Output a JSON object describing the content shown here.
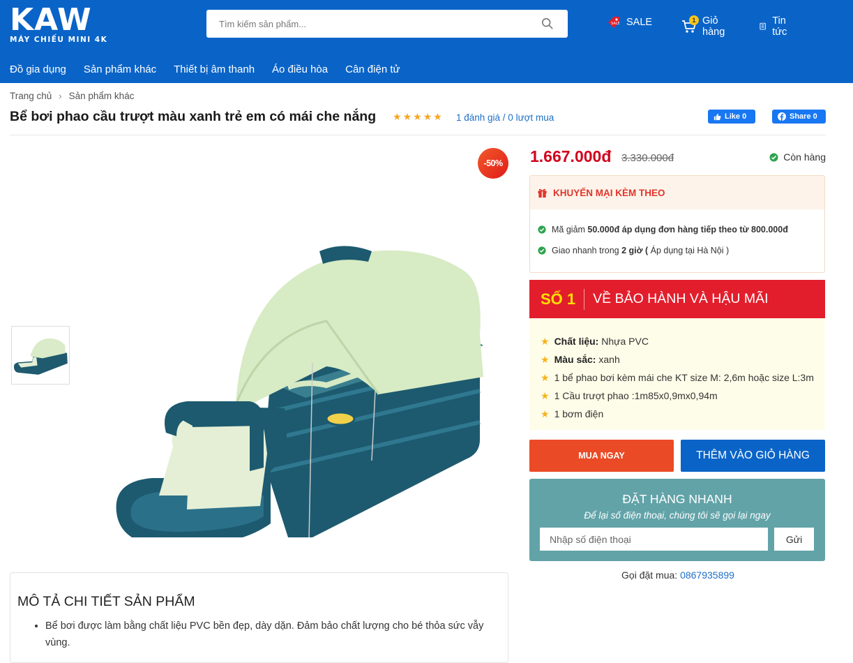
{
  "header": {
    "logo_big": "KAW",
    "logo_small": "MÁY CHIẾU MINI 4K",
    "search_placeholder": "Tìm kiếm sản phẩm...",
    "sale_label": "SALE",
    "cart_label": "Giỏ hàng",
    "cart_count": "1",
    "news_label": "Tin tức"
  },
  "nav": [
    "Đồ gia dụng",
    "Sản phẩm khác",
    "Thiết bị âm thanh",
    "Áo điều hòa",
    "Cân điện tử"
  ],
  "breadcrumb": [
    "Trang chủ",
    "Sản phẩm khác"
  ],
  "product": {
    "title": "Bể bơi phao cầu trượt màu xanh trẻ em có mái che nắng",
    "rating_text": "1 đánh giá / 0 lượt mua",
    "stars": 5,
    "like_label": "Like 0",
    "share_label": "Share 0",
    "discount_badge": "-50%",
    "price": "1.667.000đ",
    "old_price": "3.330.000đ",
    "stock": "Còn hàng"
  },
  "promo": {
    "title": "KHUYẾN MẠI KÈM THEO",
    "item1_pre": "Mã giảm ",
    "item1_bold": "50.000đ áp dụng đơn hàng tiếp theo từ 800.000đ",
    "item2_pre": "Giao nhanh trong ",
    "item2_bold": "2 giờ (",
    "item2_post": " Áp dụng tại Hà Nội )"
  },
  "warranty": {
    "so1": "SỐ 1",
    "title": "VỀ BẢO HÀNH VÀ HẬU MÃI",
    "items": [
      {
        "bold": "Chất liệu:",
        "text": " Nhựa PVC"
      },
      {
        "bold": "Màu sắc:",
        "text": " xanh"
      },
      {
        "bold": "",
        "text": "1 bể phao bơi kèm mái che KT size M: 2,6m hoặc size L:3m"
      },
      {
        "bold": "",
        "text": "1 Cầu trượt phao :1m85x0,9mx0,94m"
      },
      {
        "bold": "",
        "text": "1 bơm điện"
      }
    ]
  },
  "buttons": {
    "buy_now": "MUA NGAY",
    "add_cart": "THÊM VÀO GIỎ HÀNG"
  },
  "quick_order": {
    "title": "ĐẶT HÀNG NHANH",
    "subtitle": "Để lại số điện thoại, chúng tôi sẽ gọi lại ngay",
    "placeholder": "Nhập số điện thoại",
    "send": "Gửi"
  },
  "call": {
    "label": "Gọi đặt mua: ",
    "phone": "0867935899"
  },
  "description": {
    "title": "MÔ TẢ CHI TIẾT SẢN PHẨM",
    "items": [
      "Bể bơi được làm bằng chất liệu PVC bền đẹp, dày dặn. Đảm bảo chất lượng cho bé thỏa sức vẫy vùng."
    ]
  },
  "colors": {
    "header_blue": "#0a64c8",
    "price_red": "#d0021b",
    "buy_orange": "#ea4a26",
    "quick_teal": "#62a3a8",
    "star": "#f5a623"
  }
}
